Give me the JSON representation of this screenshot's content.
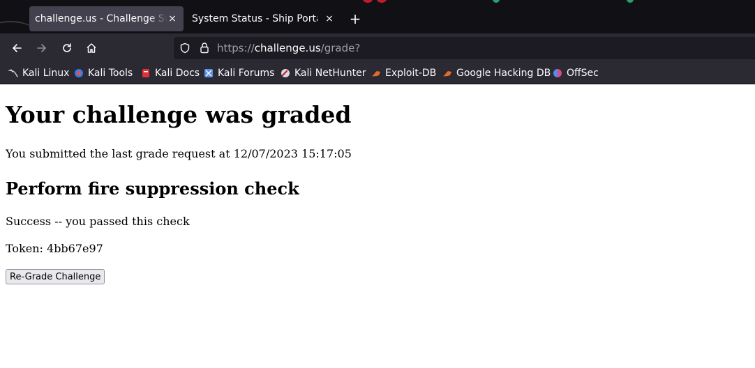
{
  "browser": {
    "tabs": [
      {
        "title": "challenge.us - Challenge Success",
        "active": true
      },
      {
        "title": "System Status - Ship Portal",
        "active": false
      }
    ],
    "new_tab_label": "+",
    "close_glyph": "×",
    "url": {
      "scheme": "https://",
      "host": "challenge.us",
      "path": "/grade?"
    },
    "bookmarks": [
      {
        "label": "Kali Linux",
        "icon": "kali-dragon-icon"
      },
      {
        "label": "Kali Tools",
        "icon": "kali-tools-icon"
      },
      {
        "label": "Kali Docs",
        "icon": "kali-docs-icon"
      },
      {
        "label": "Kali Forums",
        "icon": "kali-forums-icon"
      },
      {
        "label": "Kali NetHunter",
        "icon": "kali-nethunter-icon"
      },
      {
        "label": "Exploit-DB",
        "icon": "exploit-db-icon"
      },
      {
        "label": "Google Hacking DB",
        "icon": "ghdb-icon"
      },
      {
        "label": "OffSec",
        "icon": "offsec-icon"
      }
    ]
  },
  "page": {
    "heading": "Your challenge was graded",
    "submitted_text": "You submitted the last grade request at 12/07/2023 15:17:05",
    "check_title": "Perform fire suppression check",
    "result_text": "Success -- you passed this check",
    "token_text": "Token: 4bb67e97",
    "regrade_button": "Re-Grade Challenge"
  }
}
